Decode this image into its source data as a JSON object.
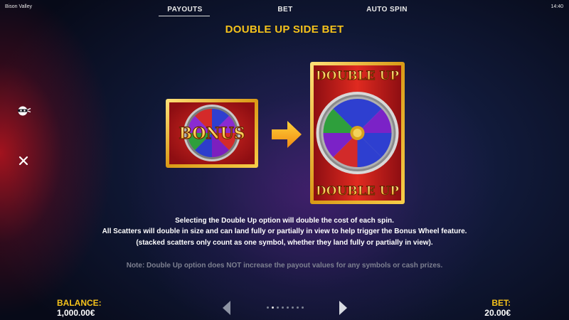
{
  "header": {
    "game_title": "Bison Valley",
    "clock": "14:40",
    "tabs": [
      {
        "label": "PAYOUTS",
        "active": true
      },
      {
        "label": "BET",
        "active": false
      },
      {
        "label": "AUTO SPIN",
        "active": false
      }
    ]
  },
  "side_buttons": [
    {
      "icon": "mask-icon"
    },
    {
      "icon": "close-icon"
    }
  ],
  "page": {
    "heading": "DOUBLE UP SIDE BET",
    "bonus_symbol_text": "BONUS",
    "double_up_text_top": "DOUBLE UP",
    "double_up_text_bottom": "DOUBLE UP",
    "description": [
      "Selecting the Double Up option will double the cost of each spin.",
      "All Scatters will double in size and can land fully or partially in view to help trigger the Bonus Wheel feature.",
      "(stacked scatters only count as one symbol, whether they land fully or partially in view)."
    ],
    "note": "Note: Double Up option does NOT increase the payout values for any symbols or cash prizes."
  },
  "footer": {
    "balance_label": "BALANCE:",
    "balance_value": "1,000.00€",
    "bet_label": "BET:",
    "bet_value": "20.00€",
    "pager": {
      "total": 8,
      "current": 2
    }
  },
  "colors": {
    "accent_gold": "#f5c21b",
    "note_gray": "#7d8090",
    "arrow_orange": "#f7a21a"
  }
}
